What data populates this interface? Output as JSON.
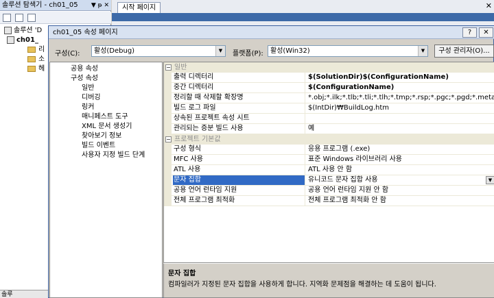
{
  "solution_explorer": {
    "title": "솔루션 탐색기 - ch01_05",
    "title_buttons": "▼ ᵽ ✕",
    "tree": [
      {
        "label": "솔루션 'D"
      },
      {
        "label": "ch01_"
      },
      {
        "label": "리"
      },
      {
        "label": "소"
      },
      {
        "label": "헤"
      }
    ],
    "bottom_label": "솔루"
  },
  "document": {
    "tab_label": "시작 페이지",
    "close_glyph": "✕"
  },
  "dialog": {
    "title": "ch01_05 속성 페이지",
    "help_label": "?",
    "close_label": "✕",
    "config_label": "구성(C):",
    "config_value": "활성(Debug)",
    "platform_label": "플랫폼(P):",
    "platform_value": "활성(Win32)",
    "config_manager_label": "구성 관리자(O)...",
    "nav": [
      {
        "label": "공용 속성",
        "indent": 0
      },
      {
        "label": "구성 속성",
        "indent": 0
      },
      {
        "label": "일반",
        "indent": 1
      },
      {
        "label": "디버깅",
        "indent": 1
      },
      {
        "label": "링커",
        "indent": 1
      },
      {
        "label": "매니페스트 도구",
        "indent": 1
      },
      {
        "label": "XML 문서 생성기",
        "indent": 1
      },
      {
        "label": "찾아보기 정보",
        "indent": 1
      },
      {
        "label": "빌드 이벤트",
        "indent": 1
      },
      {
        "label": "사용자 지정 빌드 단계",
        "indent": 1
      }
    ],
    "grid": [
      {
        "category": "일반",
        "rows": [
          {
            "name": "출력 디렉터리",
            "value": "$(SolutionDir)$(ConfigurationName)",
            "bold": true
          },
          {
            "name": "중간 디렉터리",
            "value": "$(ConfigurationName)",
            "bold": true
          },
          {
            "name": "정리할 때 삭제할 확장명",
            "value": "*.obj;*.ilk;*.tlb;*.tli;*.tlh;*.tmp;*.rsp;*.pgc;*.pgd;*.meta;$(TargetPat",
            "bold": false
          },
          {
            "name": "빌드 로그 파일",
            "value": "$(IntDir)₩BuildLog.htm",
            "bold": false
          },
          {
            "name": "상속된 프로젝트 속성 시트",
            "value": "",
            "bold": false
          },
          {
            "name": "관리되는 증분 빌드 사용",
            "value": "예",
            "bold": false
          }
        ]
      },
      {
        "category": "프로젝트 기본값",
        "rows": [
          {
            "name": "구성 형식",
            "value": "응용 프로그램 (.exe)",
            "bold": false
          },
          {
            "name": "MFC 사용",
            "value": "표준 Windows 라이브러리 사용",
            "bold": false
          },
          {
            "name": "ATL 사용",
            "value": "ATL 사용 안 함",
            "bold": false
          },
          {
            "name": "문자 집합",
            "value": "유니코드 문자 집합 사용",
            "bold": false,
            "selected": true
          },
          {
            "name": "공용 언어 런타임 지원",
            "value": "공용 언어 런타임 지원 안 함",
            "bold": false
          },
          {
            "name": "전체 프로그램 최적화",
            "value": "전체 프로그램 최적화 안 함",
            "bold": false
          }
        ]
      }
    ],
    "description": {
      "title": "문자 집합",
      "text": "컴파일러가 지정된 문자 집합을 사용하게 합니다. 지역화 문제점을 해결하는 데 도움이 됩니다."
    }
  },
  "colors": {
    "selection": "#316ac5",
    "category_bg": "#ece9d8",
    "doc_band": "#3d6aa8"
  }
}
